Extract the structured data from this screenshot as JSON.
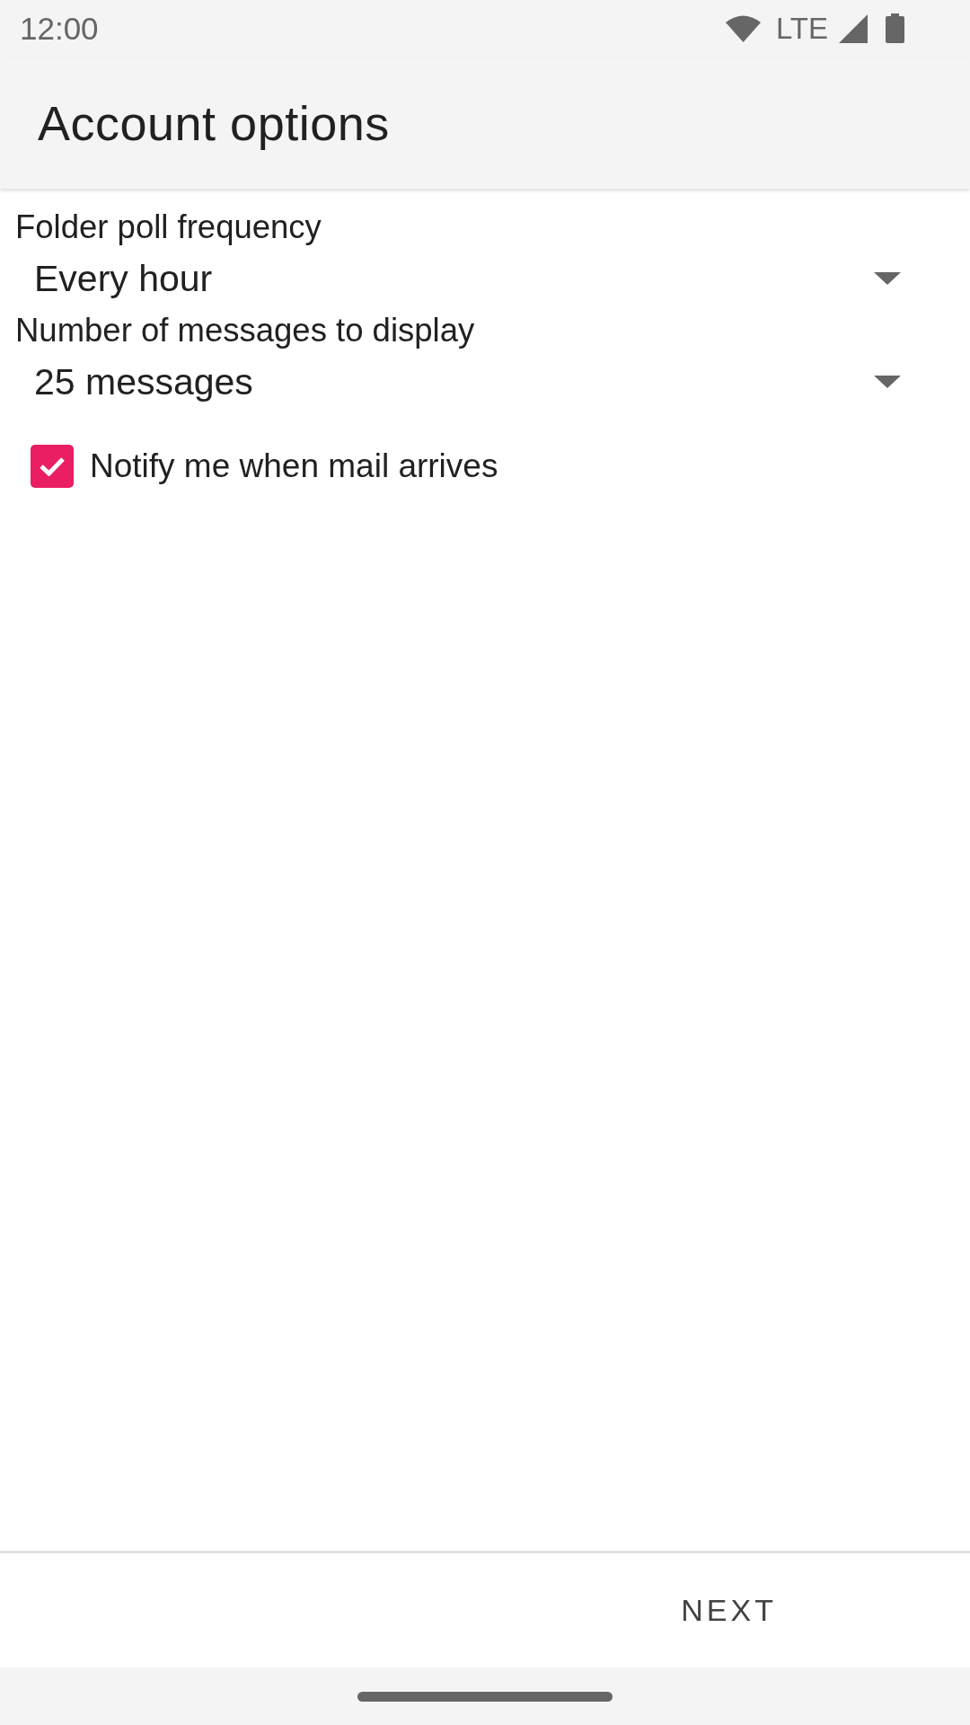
{
  "status_bar": {
    "time": "12:00",
    "network": "LTE"
  },
  "app_bar": {
    "title": "Account options"
  },
  "settings": [
    {
      "kind": "dropdown",
      "label": "Folder poll frequency",
      "value": "Every hour"
    },
    {
      "kind": "dropdown",
      "label": "Number of messages to display",
      "value": "25 messages"
    },
    {
      "kind": "checkbox",
      "label": "Notify me when mail arrives",
      "checked": true
    }
  ],
  "footer": {
    "buttons": [
      "NEXT"
    ]
  }
}
